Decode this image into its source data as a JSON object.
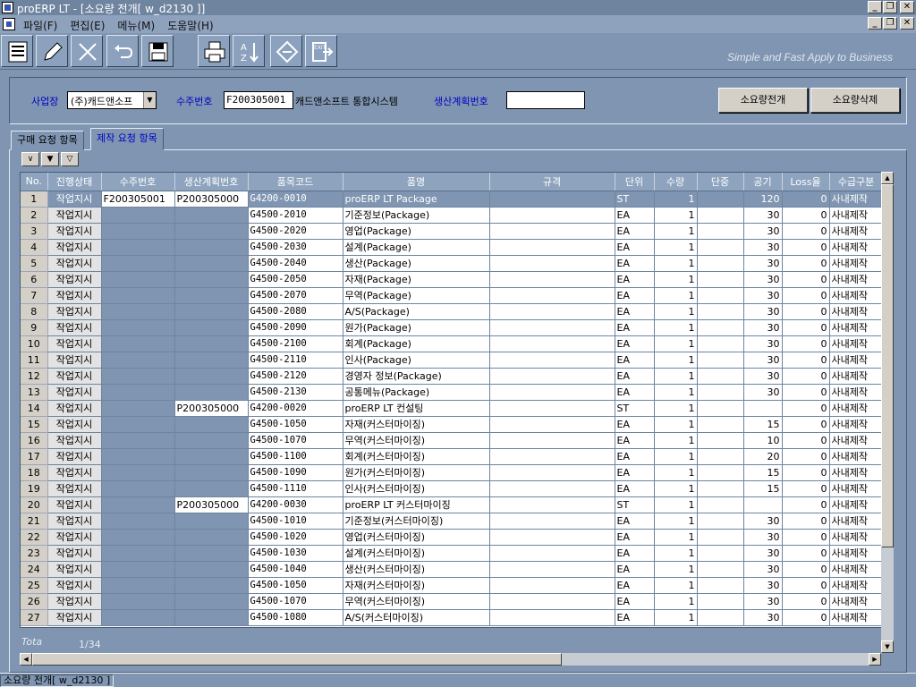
{
  "window": {
    "title": "proERP LT - [소요량 전개[ w_d2130 ]]"
  },
  "menu": {
    "items": [
      "파일(F)",
      "편집(E)",
      "메뉴(M)",
      "도움말(H)"
    ]
  },
  "toolbar": {
    "buttons": [
      {
        "name": "list-icon",
        "glyph": "≣"
      },
      {
        "name": "pencil-icon",
        "glyph": "✎"
      },
      {
        "name": "delete-x-icon",
        "glyph": "✕"
      },
      {
        "name": "undo-icon",
        "glyph": "↶"
      },
      {
        "name": "save-icon",
        "glyph": "▣"
      },
      {
        "name": "printer-icon",
        "glyph": "⎙"
      },
      {
        "name": "sort-az-icon",
        "glyph": "A↓Z"
      },
      {
        "name": "tag-icon",
        "glyph": "◇"
      },
      {
        "name": "exit-icon",
        "glyph": "EXIT"
      }
    ],
    "slogan": "Simple and Fast  Apply to Business"
  },
  "filter": {
    "site_label": "사업장",
    "site_value": "(주)캐드앤소프",
    "order_label": "수주번호",
    "order_value": "F200305001",
    "order_name": "캐드앤소프트 통합시스템",
    "plan_label": "생산계획번호",
    "plan_value": "",
    "expand_button": "소요량전개",
    "delete_button": "소요량삭제"
  },
  "tabs": [
    "구매 요청 항목",
    "제작 요청 항목"
  ],
  "small_buttons": [
    "∨",
    "▼",
    "▽"
  ],
  "grid": {
    "columns": [
      "No.",
      "진행상태",
      "수주번호",
      "생산계획번호",
      "품목코드",
      "품명",
      "규격",
      "단위",
      "수량",
      "단중",
      "공기",
      "Loss율",
      "수급구분"
    ],
    "rows": [
      [
        "1",
        "작업지시",
        "F200305001",
        "P200305000",
        "G4200-0010",
        "proERP LT Package",
        "",
        "ST",
        "1",
        "",
        "120",
        "0",
        "사내제작"
      ],
      [
        "2",
        "작업지시",
        "",
        "",
        "G4500-2010",
        "기준정보(Package)",
        "",
        "EA",
        "1",
        "",
        "30",
        "0",
        "사내제작"
      ],
      [
        "3",
        "작업지시",
        "",
        "",
        "G4500-2020",
        "영업(Package)",
        "",
        "EA",
        "1",
        "",
        "30",
        "0",
        "사내제작"
      ],
      [
        "4",
        "작업지시",
        "",
        "",
        "G4500-2030",
        "설계(Package)",
        "",
        "EA",
        "1",
        "",
        "30",
        "0",
        "사내제작"
      ],
      [
        "5",
        "작업지시",
        "",
        "",
        "G4500-2040",
        "생산(Package)",
        "",
        "EA",
        "1",
        "",
        "30",
        "0",
        "사내제작"
      ],
      [
        "6",
        "작업지시",
        "",
        "",
        "G4500-2050",
        "자재(Package)",
        "",
        "EA",
        "1",
        "",
        "30",
        "0",
        "사내제작"
      ],
      [
        "7",
        "작업지시",
        "",
        "",
        "G4500-2070",
        "무역(Package)",
        "",
        "EA",
        "1",
        "",
        "30",
        "0",
        "사내제작"
      ],
      [
        "8",
        "작업지시",
        "",
        "",
        "G4500-2080",
        "A/S(Package)",
        "",
        "EA",
        "1",
        "",
        "30",
        "0",
        "사내제작"
      ],
      [
        "9",
        "작업지시",
        "",
        "",
        "G4500-2090",
        "원가(Package)",
        "",
        "EA",
        "1",
        "",
        "30",
        "0",
        "사내제작"
      ],
      [
        "10",
        "작업지시",
        "",
        "",
        "G4500-2100",
        "회계(Package)",
        "",
        "EA",
        "1",
        "",
        "30",
        "0",
        "사내제작"
      ],
      [
        "11",
        "작업지시",
        "",
        "",
        "G4500-2110",
        "인사(Package)",
        "",
        "EA",
        "1",
        "",
        "30",
        "0",
        "사내제작"
      ],
      [
        "12",
        "작업지시",
        "",
        "",
        "G4500-2120",
        "경영자 정보(Package)",
        "",
        "EA",
        "1",
        "",
        "30",
        "0",
        "사내제작"
      ],
      [
        "13",
        "작업지시",
        "",
        "",
        "G4500-2130",
        "공통메뉴(Package)",
        "",
        "EA",
        "1",
        "",
        "30",
        "0",
        "사내제작"
      ],
      [
        "14",
        "작업지시",
        "",
        "P200305000",
        "G4200-0020",
        "proERP LT 컨설팅",
        "",
        "ST",
        "1",
        "",
        "",
        "0",
        "사내제작"
      ],
      [
        "15",
        "작업지시",
        "",
        "",
        "G4500-1050",
        "자재(커스터마이징)",
        "",
        "EA",
        "1",
        "",
        "15",
        "0",
        "사내제작"
      ],
      [
        "16",
        "작업지시",
        "",
        "",
        "G4500-1070",
        "무역(커스터마이징)",
        "",
        "EA",
        "1",
        "",
        "10",
        "0",
        "사내제작"
      ],
      [
        "17",
        "작업지시",
        "",
        "",
        "G4500-1100",
        "회계(커스터마이징)",
        "",
        "EA",
        "1",
        "",
        "20",
        "0",
        "사내제작"
      ],
      [
        "18",
        "작업지시",
        "",
        "",
        "G4500-1090",
        "원가(커스터마이징)",
        "",
        "EA",
        "1",
        "",
        "15",
        "0",
        "사내제작"
      ],
      [
        "19",
        "작업지시",
        "",
        "",
        "G4500-1110",
        "인사(커스터마이징)",
        "",
        "EA",
        "1",
        "",
        "15",
        "0",
        "사내제작"
      ],
      [
        "20",
        "작업지시",
        "",
        "P200305000",
        "G4200-0030",
        "proERP LT 커스터마이징",
        "",
        "ST",
        "1",
        "",
        "",
        "0",
        "사내제작"
      ],
      [
        "21",
        "작업지시",
        "",
        "",
        "G4500-1010",
        "기준정보(커스터마이징)",
        "",
        "EA",
        "1",
        "",
        "30",
        "0",
        "사내제작"
      ],
      [
        "22",
        "작업지시",
        "",
        "",
        "G4500-1020",
        "영업(커스터마이징)",
        "",
        "EA",
        "1",
        "",
        "30",
        "0",
        "사내제작"
      ],
      [
        "23",
        "작업지시",
        "",
        "",
        "G4500-1030",
        "설계(커스터마이징)",
        "",
        "EA",
        "1",
        "",
        "30",
        "0",
        "사내제작"
      ],
      [
        "24",
        "작업지시",
        "",
        "",
        "G4500-1040",
        "생산(커스터마이징)",
        "",
        "EA",
        "1",
        "",
        "30",
        "0",
        "사내제작"
      ],
      [
        "25",
        "작업지시",
        "",
        "",
        "G4500-1050",
        "자재(커스터마이징)",
        "",
        "EA",
        "1",
        "",
        "30",
        "0",
        "사내제작"
      ],
      [
        "26",
        "작업지시",
        "",
        "",
        "G4500-1070",
        "무역(커스터마이징)",
        "",
        "EA",
        "1",
        "",
        "30",
        "0",
        "사내제작"
      ],
      [
        "27",
        "작업지시",
        "",
        "",
        "G4500-1080",
        "A/S(커스터마이징)",
        "",
        "EA",
        "1",
        "",
        "30",
        "0",
        "사내제작"
      ]
    ]
  },
  "footer": {
    "total_label": "Tota",
    "count": "1/34"
  },
  "status": {
    "text": "소요량 전개[ w_d2130 ]"
  }
}
